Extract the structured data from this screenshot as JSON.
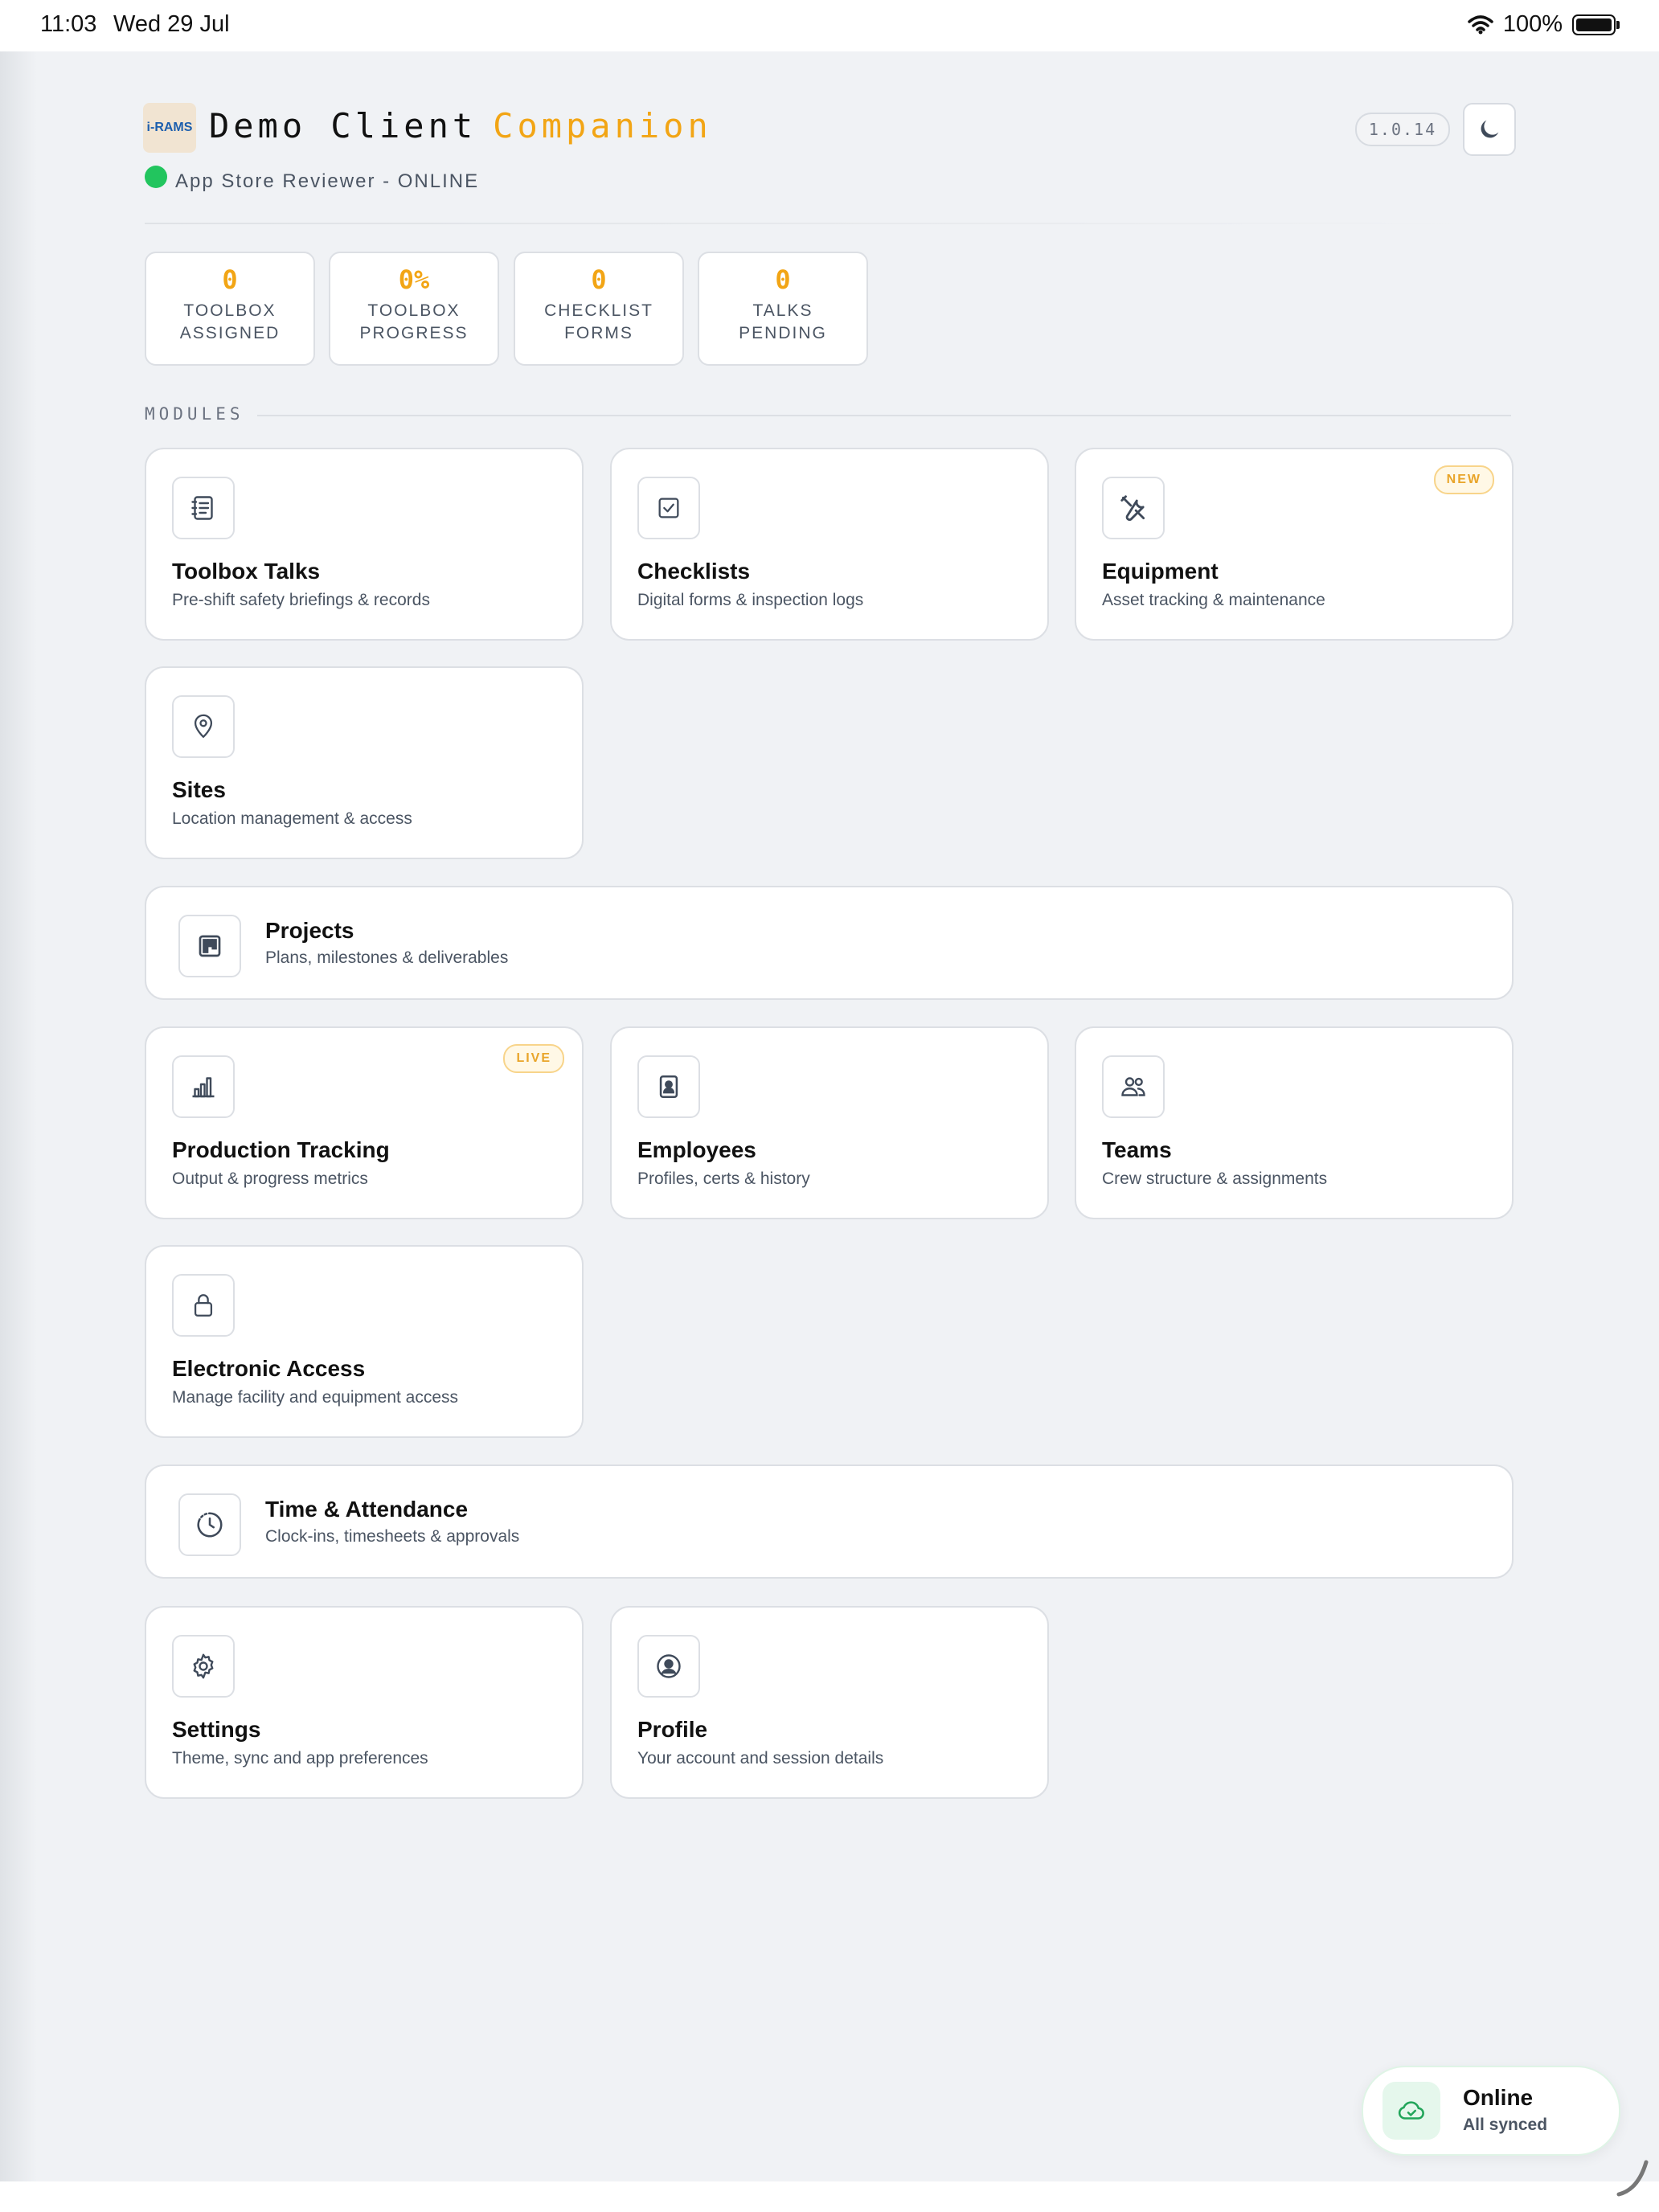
{
  "status_bar": {
    "time": "11:03",
    "date": "Wed 29 Jul",
    "battery": "100%"
  },
  "header": {
    "logo_text": "i-RAMS",
    "title": "Demo Client",
    "title_accent": "Companion",
    "user_status": "App Store Reviewer - ONLINE",
    "version": "1.0.14"
  },
  "stats": [
    {
      "value": "0",
      "label_line1": "TOOLBOX",
      "label_line2": "ASSIGNED"
    },
    {
      "value": "0%",
      "label_line1": "TOOLBOX",
      "label_line2": "PROGRESS"
    },
    {
      "value": "0",
      "label_line1": "CHECKLIST",
      "label_line2": "FORMS"
    },
    {
      "value": "0",
      "label_line1": "TALKS",
      "label_line2": "PENDING"
    }
  ],
  "modules_heading": "MODULES",
  "modules": [
    {
      "title": "Toolbox Talks",
      "desc": "Pre-shift safety briefings & records",
      "icon": "notebook-icon"
    },
    {
      "title": "Checklists",
      "desc": "Digital forms & inspection logs",
      "icon": "checkbox-icon"
    },
    {
      "title": "Equipment",
      "desc": "Asset tracking & maintenance",
      "icon": "tools-icon",
      "badge": "NEW"
    },
    {
      "title": "Sites",
      "desc": "Location management & access",
      "icon": "map-pin-icon"
    },
    {
      "title": "Projects",
      "desc": "Plans, milestones & deliverables",
      "icon": "kanban-icon"
    },
    {
      "title": "Production Tracking",
      "desc": "Output & progress metrics",
      "icon": "bar-chart-icon",
      "badge": "LIVE"
    },
    {
      "title": "Employees",
      "desc": "Profiles, certs & history",
      "icon": "id-badge-icon"
    },
    {
      "title": "Teams",
      "desc": "Crew structure & assignments",
      "icon": "users-icon"
    },
    {
      "title": "Electronic Access",
      "desc": "Manage facility and equipment access",
      "icon": "lock-icon"
    },
    {
      "title": "Time & Attendance",
      "desc": "Clock-ins, timesheets & approvals",
      "icon": "clock-icon"
    },
    {
      "title": "Settings",
      "desc": "Theme, sync and app preferences",
      "icon": "gear-icon"
    },
    {
      "title": "Profile",
      "desc": "Your account and session details",
      "icon": "user-circle-icon"
    }
  ],
  "sync": {
    "title": "Online",
    "subtitle": "All synced",
    "icon": "cloud-check-icon"
  },
  "colors": {
    "accent": "#f2a515",
    "online": "#22c55e",
    "background": "#f0f2f5"
  }
}
